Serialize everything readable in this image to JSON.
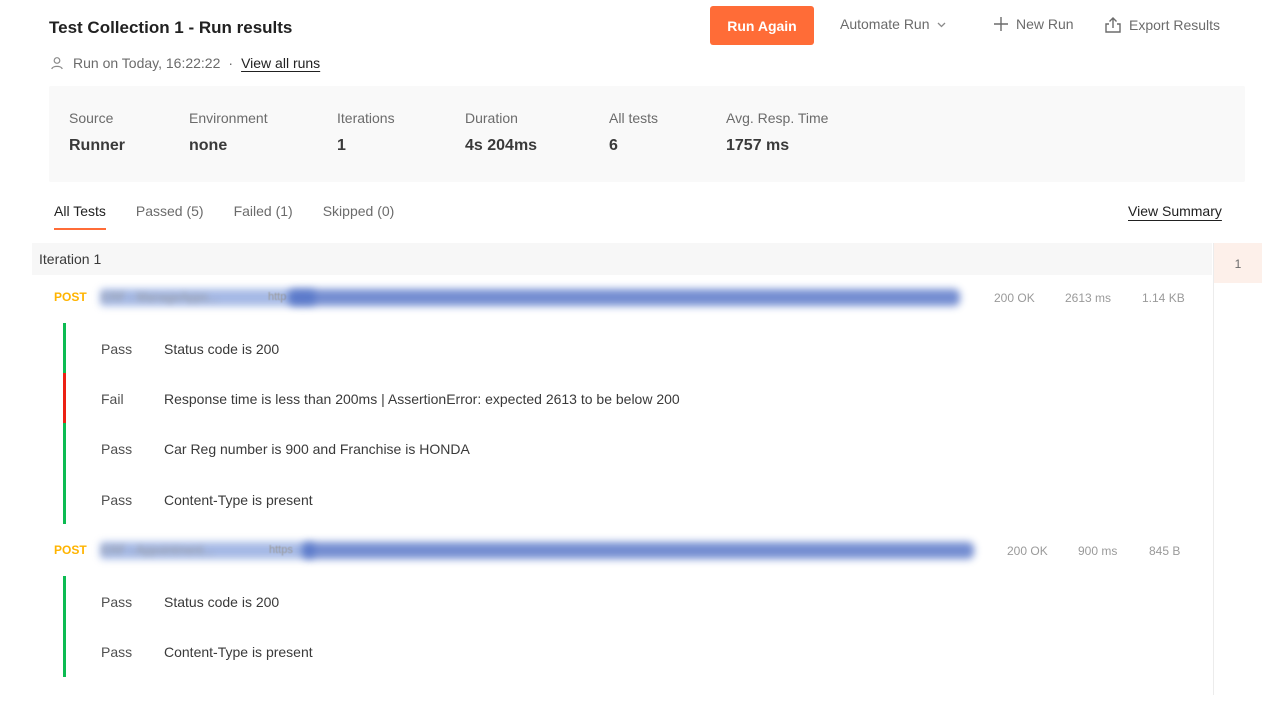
{
  "header": {
    "title": "Test Collection 1 - Run results",
    "run_on": "Run on Today, 16:22:22",
    "separator": "·",
    "view_all_runs": "View all runs",
    "run_again": "Run Again",
    "automate_run": "Automate Run",
    "new_run": "New Run",
    "export_results": "Export Results",
    "accent_color": "#ff6c37"
  },
  "summary": [
    {
      "label": "Source",
      "value": "Runner"
    },
    {
      "label": "Environment",
      "value": "none"
    },
    {
      "label": "Iterations",
      "value": "1"
    },
    {
      "label": "Duration",
      "value": "4s 204ms"
    },
    {
      "label": "All tests",
      "value": "6"
    },
    {
      "label": "Avg. Resp. Time",
      "value": "1757 ms"
    }
  ],
  "tabs": [
    {
      "label": "All Tests",
      "active": true
    },
    {
      "label": "Passed (5)",
      "active": false
    },
    {
      "label": "Failed (1)",
      "active": false
    },
    {
      "label": "Skipped (0)",
      "active": false
    }
  ],
  "view_summary": "View Summary",
  "iteration": {
    "label": "Iteration 1",
    "number": "1"
  },
  "requests": [
    {
      "method": "POST",
      "name": "ERF - ManageAppo...",
      "url_prefix": "http",
      "status": "200 OK",
      "time": "2613 ms",
      "size": "1.14 KB",
      "tests": [
        {
          "result": "Pass",
          "text": "Status code is 200"
        },
        {
          "result": "Fail",
          "text": "Response time is less than 200ms | AssertionError: expected 2613 to be below 200"
        },
        {
          "result": "Pass",
          "text": "Car Reg number is 900 and Franchise is HONDA"
        },
        {
          "result": "Pass",
          "text": "Content-Type is present"
        }
      ]
    },
    {
      "method": "POST",
      "name": "ERF - Appointment...",
      "url_prefix": "https",
      "status": "200 OK",
      "time": "900 ms",
      "size": "845 B",
      "tests": [
        {
          "result": "Pass",
          "text": "Status code is 200"
        },
        {
          "result": "Pass",
          "text": "Content-Type is present"
        }
      ]
    }
  ],
  "colors": {
    "pass": "#0cbb52",
    "fail": "#eb2013",
    "method_post": "#ffb400"
  }
}
